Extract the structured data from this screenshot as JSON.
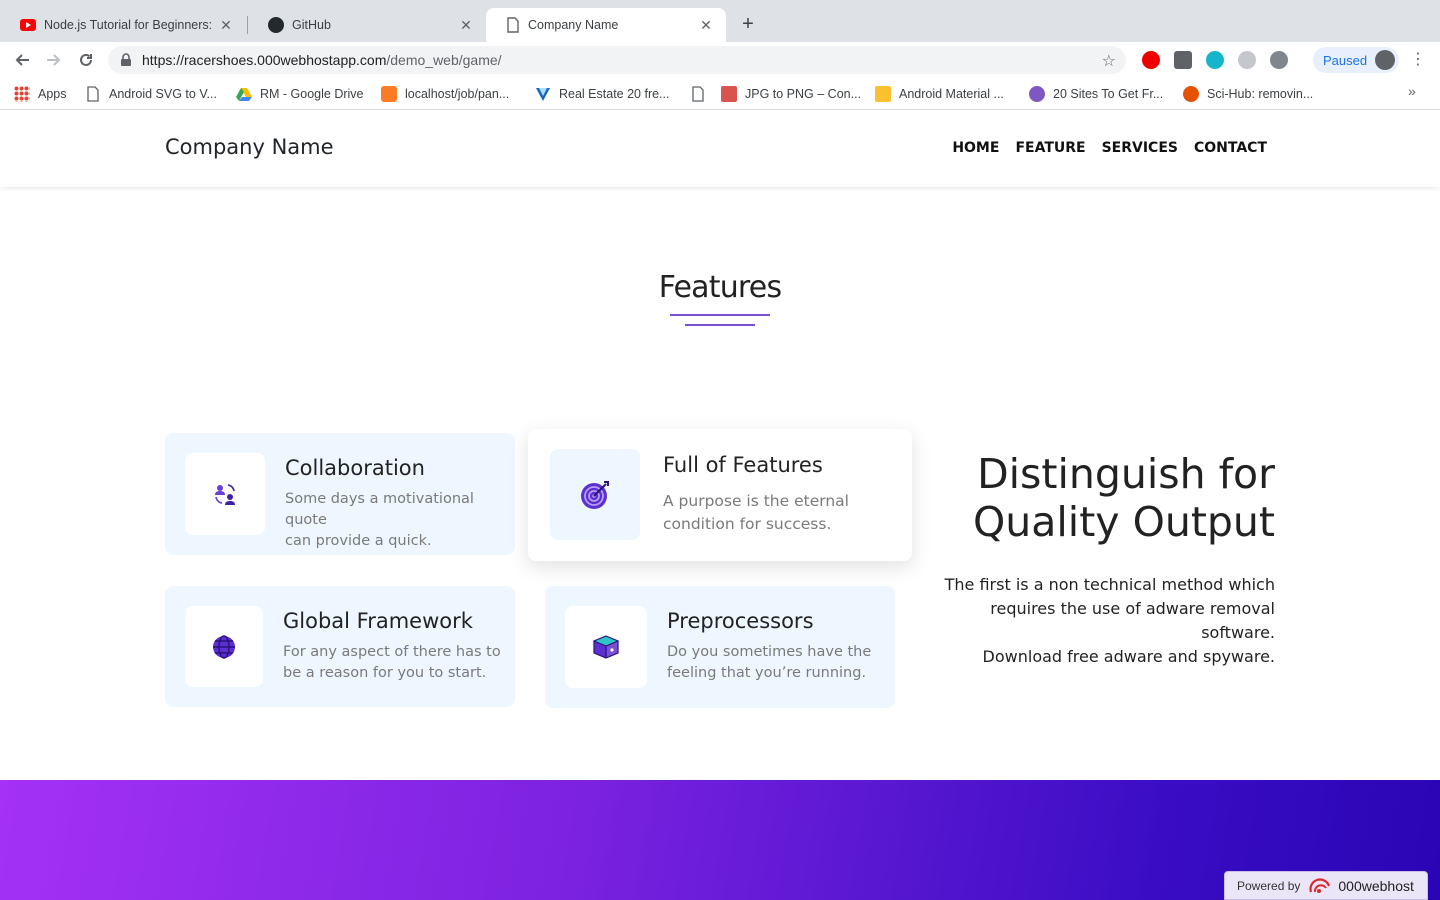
{
  "browser": {
    "tabs": [
      {
        "title": "Node.js Tutorial for Beginners:",
        "favicon": "youtube-icon"
      },
      {
        "title": "GitHub",
        "favicon": "github-icon"
      },
      {
        "title": "Company Name",
        "favicon": "document-icon"
      }
    ],
    "url_host": "https://racershoes.000webhostapp.com",
    "url_path": "/demo_web/game/",
    "profile_label": "Paused",
    "bookmarks": [
      {
        "label": "Apps",
        "icon": "apps-grid-icon"
      },
      {
        "label": "Android SVG to V...",
        "icon": "document-icon"
      },
      {
        "label": "RM - Google Drive",
        "icon": "google-drive-icon"
      },
      {
        "label": "localhost/job/pan...",
        "icon": "xampp-icon"
      },
      {
        "label": "Real Estate 20 fre...",
        "icon": "vuetify-icon"
      },
      {
        "label": "",
        "icon": "document-icon"
      },
      {
        "label": "JPG to PNG – Con...",
        "icon": "jpg-png-icon"
      },
      {
        "label": "Android Material ...",
        "icon": "material-icon"
      },
      {
        "label": "20 Sites To Get Fr...",
        "icon": "globe-icon"
      },
      {
        "label": "Sci-Hub: removin...",
        "icon": "sci-hub-icon"
      }
    ]
  },
  "site": {
    "brand": "Company Name",
    "nav": [
      "HOME",
      "FEATURE",
      "SERVICES",
      "CONTACT"
    ],
    "features_title": "Features",
    "cards": [
      {
        "title": "Collaboration",
        "text_line1": "Some days a motivational quote",
        "text_line2": "can provide a quick.",
        "icon": "collaboration-icon"
      },
      {
        "title": "Full of Features",
        "text_line1": "A purpose is the eternal",
        "text_line2": "condition for success.",
        "icon": "target-icon"
      },
      {
        "title": "Global Framework",
        "text_line1": "For any aspect of there has to",
        "text_line2": "be a reason for you to start.",
        "icon": "globe-icon"
      },
      {
        "title": "Preprocessors",
        "text_line1": "Do you sometimes have the",
        "text_line2": "feeling that you’re running.",
        "icon": "box-icon"
      }
    ],
    "distinguish_line1": "Distinguish for",
    "distinguish_line2": "Quality Output",
    "distinguish_text_line1": "The first is a non technical method which",
    "distinguish_text_line2": "requires the use of adware removal software.",
    "distinguish_text_line3": "Download free adware and spyware.",
    "powered_by": "Powered by",
    "powered_brand": "000webhost",
    "colors": {
      "accent": "#7b4fd1",
      "card_bg": "#eef7ff",
      "gradient_start": "#a431f5",
      "gradient_end": "#2a05b5"
    }
  }
}
